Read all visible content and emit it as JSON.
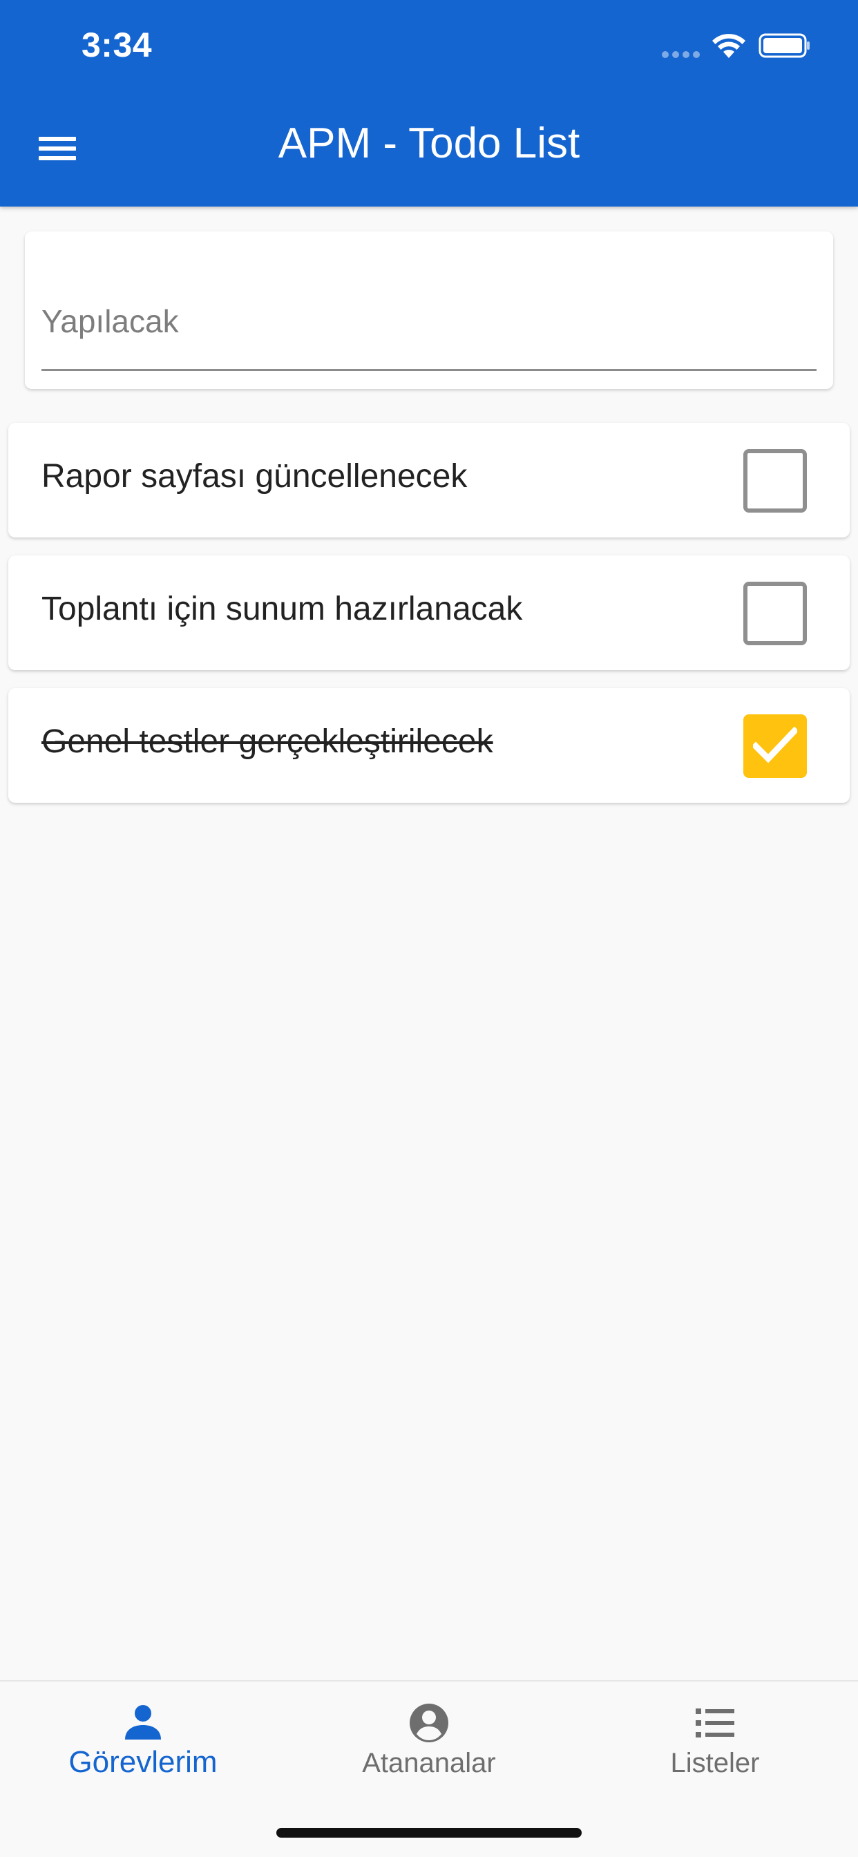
{
  "status_bar": {
    "time": "3:34"
  },
  "header": {
    "title": "APM - Todo List",
    "color": "#1565d0"
  },
  "input": {
    "placeholder": "Yapılacak",
    "value": ""
  },
  "tasks": [
    {
      "text": "Rapor sayfası güncellenecek",
      "done": false
    },
    {
      "text": "Toplantı için sunum hazırlanacak",
      "done": false
    },
    {
      "text": "Genel testler gerçekleştirilecek",
      "done": true
    }
  ],
  "checkbox_checked_color": "#ffc20e",
  "bottom_nav": {
    "items": [
      {
        "label": "Görevlerim",
        "icon": "person-icon",
        "active": true
      },
      {
        "label": "Atananalar",
        "icon": "account-circle-icon",
        "active": false
      },
      {
        "label": "Listeler",
        "icon": "list-icon",
        "active": false
      }
    ]
  }
}
